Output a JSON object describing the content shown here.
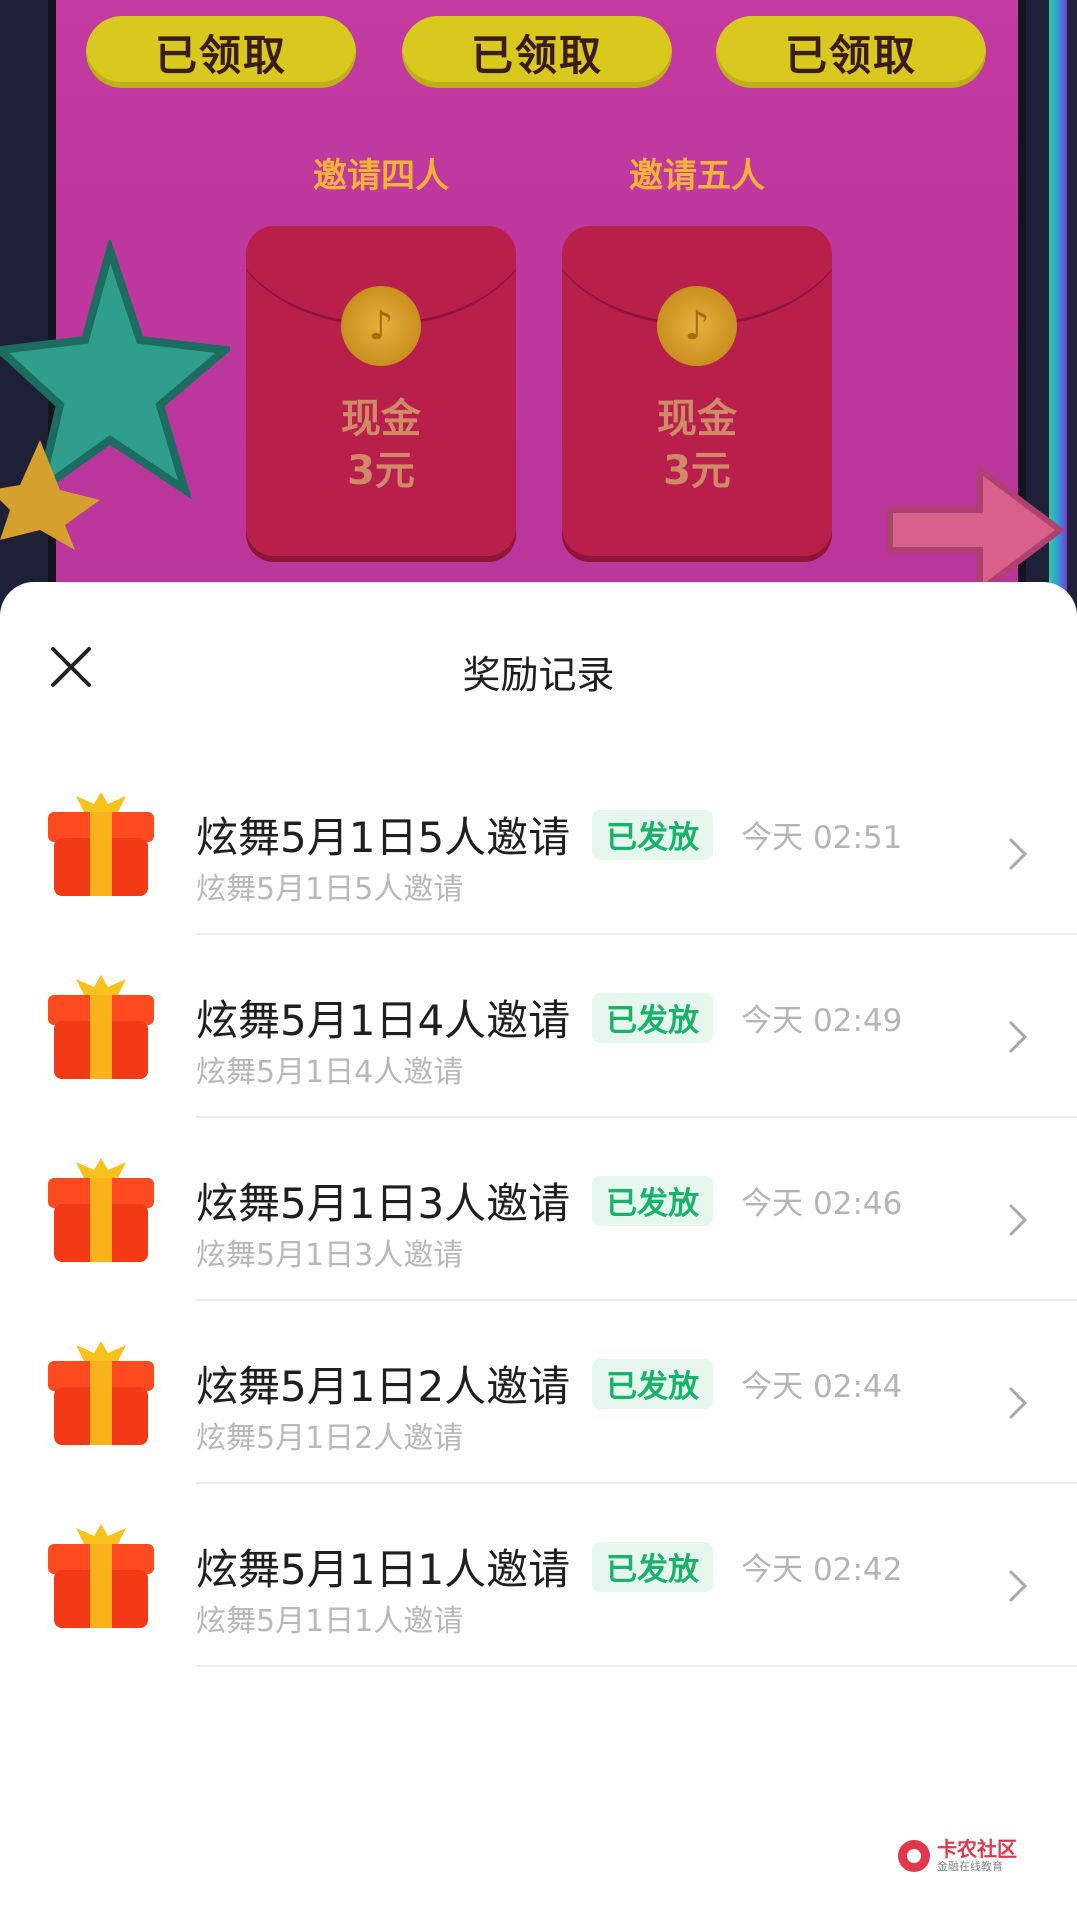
{
  "background": {
    "claim_buttons": [
      "已领取",
      "已领取",
      "已领取"
    ],
    "invites": [
      {
        "title": "邀请四人",
        "reward_line1": "现金",
        "reward_line2": "3元"
      },
      {
        "title": "邀请五人",
        "reward_line1": "现金",
        "reward_line2": "3元"
      }
    ]
  },
  "sheet": {
    "title": "奖励记录",
    "records": [
      {
        "title": "炫舞5月1日5人邀请",
        "status": "已发放",
        "time": "今天 02:51",
        "subtitle": "炫舞5月1日5人邀请"
      },
      {
        "title": "炫舞5月1日4人邀请",
        "status": "已发放",
        "time": "今天 02:49",
        "subtitle": "炫舞5月1日4人邀请"
      },
      {
        "title": "炫舞5月1日3人邀请",
        "status": "已发放",
        "time": "今天 02:46",
        "subtitle": "炫舞5月1日3人邀请"
      },
      {
        "title": "炫舞5月1日2人邀请",
        "status": "已发放",
        "time": "今天 02:44",
        "subtitle": "炫舞5月1日2人邀请"
      },
      {
        "title": "炫舞5月1日1人邀请",
        "status": "已发放",
        "time": "今天 02:42",
        "subtitle": "炫舞5月1日1人邀请"
      }
    ]
  },
  "watermark": {
    "main": "卡农社区",
    "sub": "金融在线教育"
  },
  "colors": {
    "status_green": "#17b36b",
    "status_bg": "#e6f7ee",
    "overlay_pink": "#c33aa0"
  }
}
